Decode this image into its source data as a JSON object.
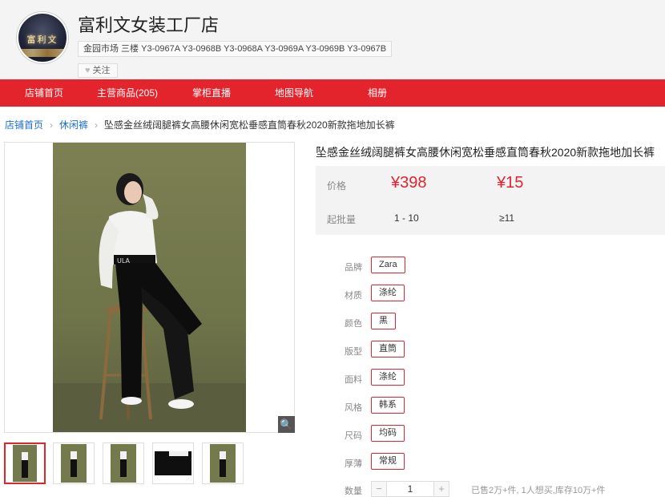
{
  "shop": {
    "logo_text": "富利文",
    "name": "富利文女装工厂店",
    "address": "金园市场 三楼 Y3-0967A Y3-0968B Y3-0968A Y3-0969A Y3-0969B Y3-0967B",
    "follow_label": "关注"
  },
  "nav": {
    "items": [
      "店铺首页",
      "主营商品(205)",
      "掌柜直播",
      "地图导航",
      "相册"
    ]
  },
  "breadcrumb": {
    "home": "店铺首页",
    "category": "休闲裤",
    "current": "坠感金丝绒阔腿裤女高腰休闲宽松垂感直筒春秋2020新款拖地加长裤"
  },
  "product": {
    "title": "坠感金丝绒阔腿裤女高腰休闲宽松垂感直筒春秋2020新款拖地加长裤",
    "price_label": "价格",
    "price_1": "¥398",
    "price_2": "¥15",
    "batch_label": "起批量",
    "batch_1": "1 - 10",
    "batch_2": "≥11",
    "attributes": [
      {
        "label": "品牌",
        "value": "Zara"
      },
      {
        "label": "材质",
        "value": "涤纶"
      },
      {
        "label": "颜色",
        "value": "黑"
      },
      {
        "label": "版型",
        "value": "直筒"
      },
      {
        "label": "面料",
        "value": "涤纶"
      },
      {
        "label": "风格",
        "value": "韩系"
      },
      {
        "label": "尺码",
        "value": "均码"
      },
      {
        "label": "厚薄",
        "value": "常规"
      }
    ],
    "quantity_label": "数量",
    "quantity_value": "1",
    "sales_info": "已售2万+件, 1人想买,库存10万+件"
  },
  "colors": {
    "accent": "#e4242c",
    "link": "#1a6fd1",
    "photo_background": "#6f7449"
  },
  "icons": {
    "zoom": "magnifier-icon",
    "follow": "heart-icon",
    "breadcrumb_separator": "chevron-right-icon"
  }
}
